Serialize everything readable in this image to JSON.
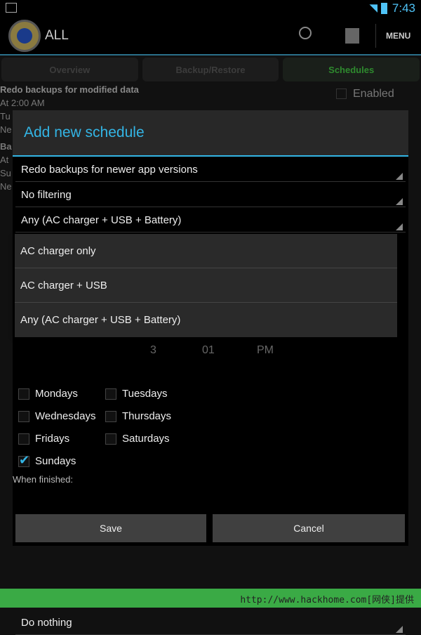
{
  "status": {
    "time": "7:43"
  },
  "actionbar": {
    "title": "ALL",
    "menu": "MENU"
  },
  "tabs": [
    {
      "label": "Overview"
    },
    {
      "label": "Backup/Restore"
    },
    {
      "label": "Schedules",
      "active": true
    }
  ],
  "background": {
    "schedule_title": "Redo backups for modified data",
    "schedule_time": "At 2:00 AM",
    "enabled_label": "Enabled",
    "fragments": [
      "Tu",
      "Ne",
      "Ba",
      "At",
      "Su",
      "Ne"
    ]
  },
  "dialog": {
    "title": "Add new schedule",
    "spinners": [
      "Redo backups for newer app versions",
      "No filtering",
      "Any (AC charger + USB + Battery)"
    ],
    "dropdown_options": [
      "AC charger only",
      "AC charger + USB",
      "Any (AC charger + USB + Battery)"
    ],
    "time": {
      "hour": "3",
      "minute": "01",
      "ampm": "PM"
    },
    "days": [
      {
        "label": "Mondays",
        "checked": false
      },
      {
        "label": "Tuesdays",
        "checked": false
      },
      {
        "label": "Wednesdays",
        "checked": false
      },
      {
        "label": "Thursdays",
        "checked": false
      },
      {
        "label": "Fridays",
        "checked": false
      },
      {
        "label": "Saturdays",
        "checked": false
      },
      {
        "label": "Sundays",
        "checked": true
      }
    ],
    "when_finished_label": "When finished:",
    "when_finished_value": "Do nothing",
    "save": "Save",
    "cancel": "Cancel"
  },
  "footer": {
    "watermark": "http://www.hackhome.com[网侠]提供"
  },
  "colors": {
    "accent": "#33b5e5",
    "active_tab": "#2e8a2e",
    "watermark_bg": "#3aaa45"
  }
}
